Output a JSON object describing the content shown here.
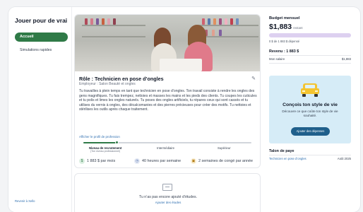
{
  "sidebar": {
    "title": "Jouer pour de vrai",
    "active_item": "Accueil",
    "items": [
      {
        "label": "Simulations rapides"
      }
    ],
    "footer_link": "Revenir à Xello"
  },
  "job_card": {
    "role_title": "Rôle : Technicien en pose d’ongles",
    "employer": "Employeur : Salon Beauté et ongles",
    "description": "Tu travailles à plein temps en tant que technicien en pose d’ongles. Ton travail consiste à rendre les ongles des gens magnifiques. Tu fais trempez, nettoies et masses les mains et les pieds des clients. Tu coupes les cuticules et tu polis et limes les ongles naturels. Tu poses des ongles artificiels, tu répares ceux qui sont cassés et tu utilises du vernis à ongles, des décalcomanies et des pierres précieuses pour créer des motifs. Tu nettoies et stérilises les outils après chaque traitement.",
    "profile_link": "Afficher le profil de profession",
    "levels": {
      "current_label": "Niveau de recrutement",
      "current_sub": "(Ton niveau professionnel)",
      "middle": "Intermédiaire",
      "top": "Supérieur",
      "progress": 0.2
    },
    "stats": {
      "pay": "1 883 $ par mois",
      "hours": "40 heures par semaine",
      "vacation": "2 semaines de congé par année"
    }
  },
  "studies": {
    "message": "Tu n’as pas encore ajouté d’études.",
    "add_link": "Ajouter des études"
  },
  "budget": {
    "label": "Budget mensuel",
    "amount": "$1,883",
    "amount_suffix": "restant",
    "spent_fraction": 0,
    "note": "0 $ de 1 883 $ dépensé",
    "revenue_title": "Revenu : 1 883 $",
    "salary_label": "Mon salaire",
    "salary_value": "$1,883"
  },
  "promo": {
    "title": "Conçois ton style de vie",
    "text": "Découvre ce que coûte ton style de vie souhaité.",
    "button": "Ajouter des dépenses",
    "accent": "#f4c430"
  },
  "payslip": {
    "title": "Talon de paye",
    "item_label": "Technicien en pose d’ongles",
    "item_date": "Août 2025"
  },
  "colors": {
    "accent_green": "#2f7a47",
    "link_blue": "#2f6fb0",
    "budget_bar": "#ddd0f0",
    "promo_bg": "#d6ecf7",
    "promo_button": "#1f5f8b"
  }
}
